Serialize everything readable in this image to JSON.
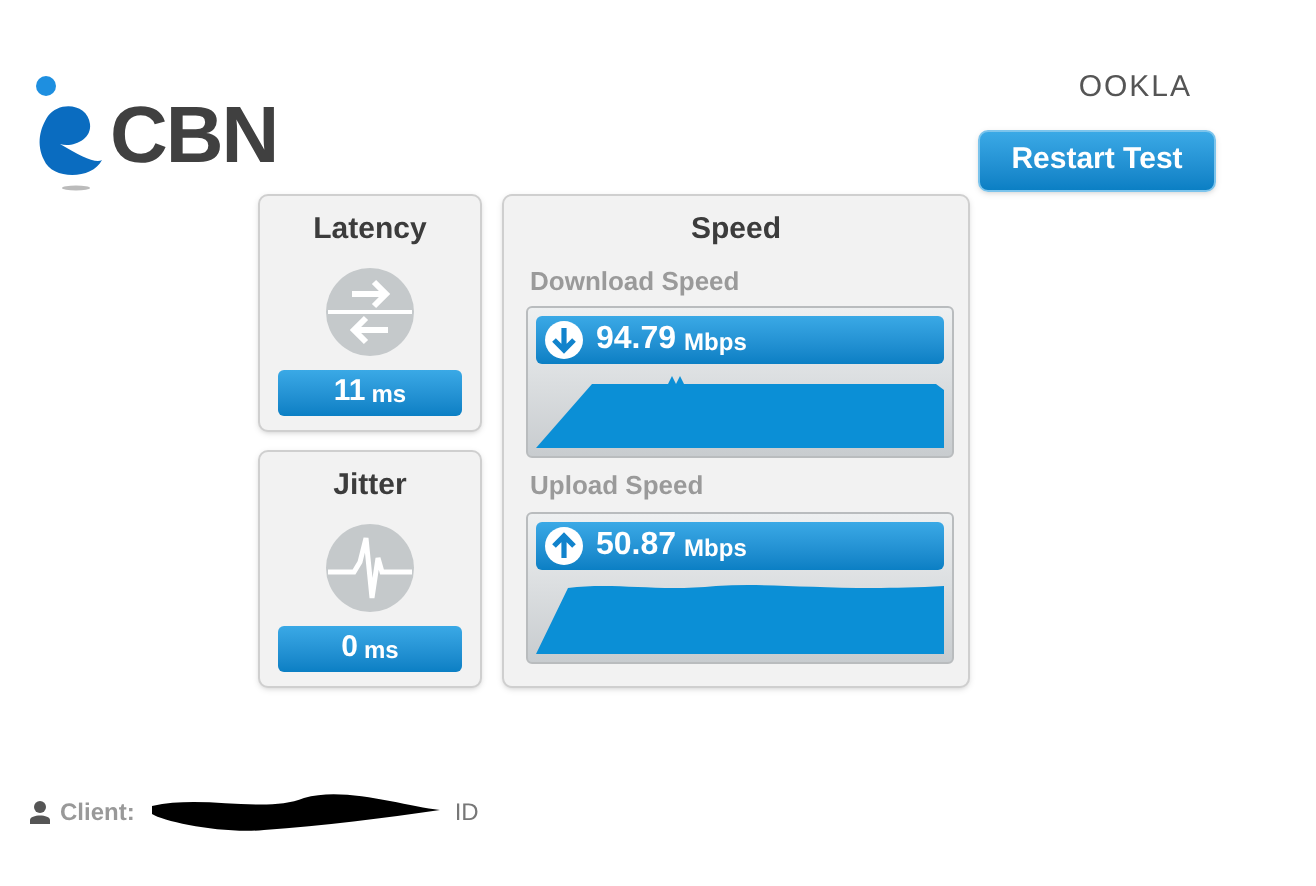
{
  "header": {
    "logo_text": "CBN",
    "brand_text": "OOKLA",
    "restart_button": "Restart Test"
  },
  "metrics": [
    {
      "kind": "latency",
      "title": "Latency",
      "value": "11",
      "unit": "ms"
    },
    {
      "kind": "jitter",
      "title": "Jitter",
      "value": "0",
      "unit": "ms"
    }
  ],
  "speed": {
    "title": "Speed",
    "items": [
      {
        "kind": "download",
        "label": "Download Speed",
        "value": "94.79",
        "unit": "Mbps"
      },
      {
        "kind": "upload",
        "label": "Upload Speed",
        "value": "50.87",
        "unit": "Mbps"
      }
    ]
  },
  "footer": {
    "label": "Client:",
    "suffix": "ID"
  }
}
